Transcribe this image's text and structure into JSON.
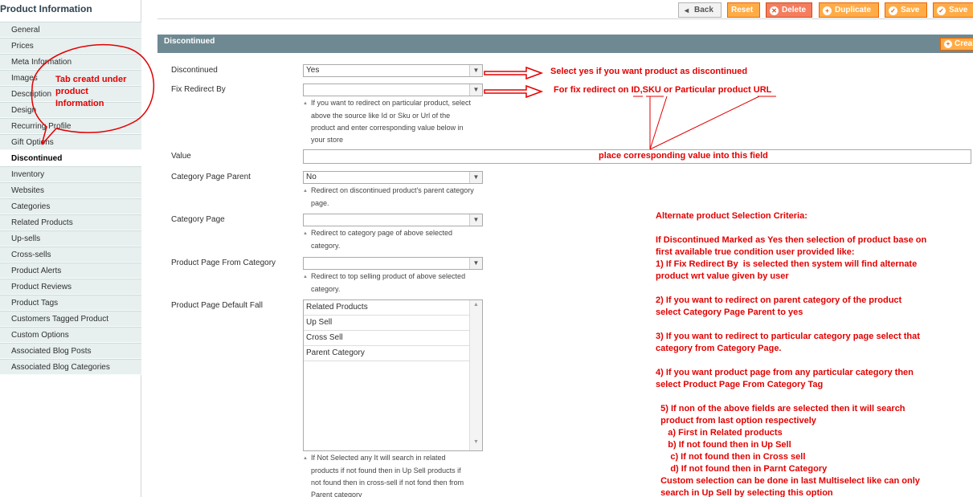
{
  "sidebar": {
    "title": "Product Information",
    "tabs": [
      {
        "label": "General"
      },
      {
        "label": "Prices"
      },
      {
        "label": "Meta Information"
      },
      {
        "label": "Images"
      },
      {
        "label": "Description"
      },
      {
        "label": "Design"
      },
      {
        "label": "Recurring Profile"
      },
      {
        "label": "Gift Options"
      },
      {
        "label": "Discontinued",
        "active": true
      },
      {
        "label": "Inventory"
      },
      {
        "label": "Websites"
      },
      {
        "label": "Categories"
      },
      {
        "label": "Related Products"
      },
      {
        "label": "Up-sells"
      },
      {
        "label": "Cross-sells"
      },
      {
        "label": "Product Alerts"
      },
      {
        "label": "Product Reviews"
      },
      {
        "label": "Product Tags"
      },
      {
        "label": "Customers Tagged Product"
      },
      {
        "label": "Custom Options"
      },
      {
        "label": "Associated Blog Posts"
      },
      {
        "label": "Associated Blog Categories"
      }
    ]
  },
  "toolbar": {
    "back": "Back",
    "reset": "Reset",
    "delete": "Delete",
    "duplicate": "Duplicate",
    "save": "Save",
    "save_continue": "Save"
  },
  "section": {
    "title": "Discontinued",
    "create_label": "Crea"
  },
  "form": {
    "discontinued": {
      "label": "Discontinued",
      "value": "Yes"
    },
    "fix_redirect": {
      "label": "Fix Redirect By",
      "value": "",
      "note": [
        "If you want to redirect on particular product, select",
        "above the source like Id or Sku or Url of the",
        "product and enter corresponding value below in",
        "your store"
      ]
    },
    "value": {
      "label": "Value"
    },
    "category_parent": {
      "label": "Category Page Parent",
      "value": "No",
      "note": [
        "Redirect on discontinued product's parent category",
        "page."
      ]
    },
    "category_page": {
      "label": "Category Page",
      "value": "",
      "note": [
        "Redirect to category page of above selected",
        "category."
      ]
    },
    "product_from_category": {
      "label": "Product Page From Category",
      "value": "",
      "note": [
        "Redirect to top selling product of above selected",
        "category."
      ]
    },
    "default_fall": {
      "label": "Product Page Default Fall",
      "options": [
        "Related Products",
        "Up Sell",
        "Cross Sell",
        "Parent Category"
      ],
      "note": [
        "If Not Selected any It will search in related",
        "products if not found then in Up Sell products if",
        "not found then in cross-sell if not fond then from",
        "Parent category"
      ]
    }
  },
  "annotations": {
    "tab_bubble": [
      "Tab creatd under",
      "product",
      "Information"
    ],
    "select_yes": "Select yes if you want product as discontinued",
    "fix_redirect": "For fix redirect on ID,SKU or Particular product URL",
    "place_value": "place corresponding value into this field",
    "criteria": [
      "Alternate product Selection Criteria:",
      "",
      "If Discontinued Marked as Yes then selection of product base on",
      "first available true condition user provided like:",
      "1) If Fix Redirect By  is selected then system will find alternate",
      "product wrt value given by user",
      "",
      "2) If you want to redirect on parent category of the product",
      "select Category Page Parent to yes",
      "",
      "3) If you want to redirect to particular category page select that",
      "category from Category Page.",
      "",
      "4) If you want product page from any particular category then",
      "select Product Page From Category Tag",
      "",
      "  5) If non of the above fields are selected then it will search",
      "  product from last option respectively",
      "     a) First in Related products",
      "     b) If not found then in Up Sell",
      "      c) If not found then in Cross sell",
      "      d) If not found then in Parnt Category",
      "  Custom selection can be done in last Multiselect like can only",
      "  search in Up Sell by selecting this option"
    ]
  },
  "colors": {
    "accent": "#ffac47",
    "annotation": "#e30000",
    "section_head": "#6f8992",
    "tab_bg": "#e7efef"
  }
}
